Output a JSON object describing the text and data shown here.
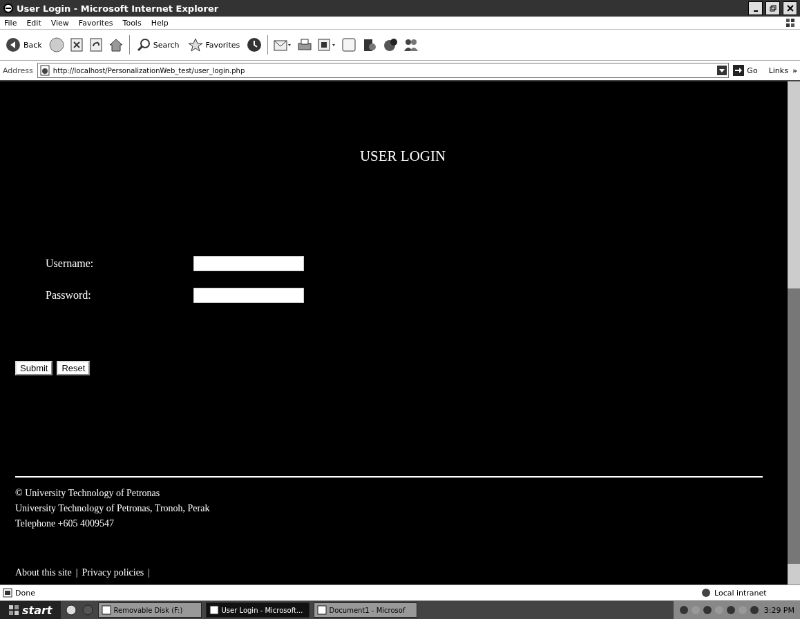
{
  "window": {
    "title": "User Login - Microsoft Internet Explorer"
  },
  "menu": [
    "File",
    "Edit",
    "View",
    "Favorites",
    "Tools",
    "Help"
  ],
  "toolbar": {
    "back": "Back",
    "search": "Search",
    "favorites": "Favorites"
  },
  "address": {
    "label": "Address",
    "url": "http://localhost/PersonalizationWeb_test/user_login.php",
    "go": "Go",
    "links": "Links",
    "more": "»"
  },
  "page": {
    "heading": "USER LOGIN",
    "fields": [
      {
        "label": "Username:"
      },
      {
        "label": "Password:"
      }
    ],
    "buttons": [
      "Submit",
      "Reset"
    ],
    "footer": [
      "© University Technology of Petronas",
      "University Technology of Petronas, Tronoh, Perak",
      "Telephone +605 4009547"
    ],
    "links": [
      {
        "label": "About this site",
        "separator": "|"
      },
      {
        "label": "Privacy policies",
        "separator": "|"
      }
    ]
  },
  "status_bar": {
    "text": "Done",
    "zone": "Local intranet"
  },
  "taskbar": {
    "start": "start",
    "tasks": [
      {
        "label": "Removable Disk (F:)",
        "selected": false
      },
      {
        "label": "User Login - Microsoft...",
        "selected": true
      },
      {
        "label": "Document1 - Microsof",
        "selected": false
      }
    ],
    "time": "3:29 PM"
  }
}
